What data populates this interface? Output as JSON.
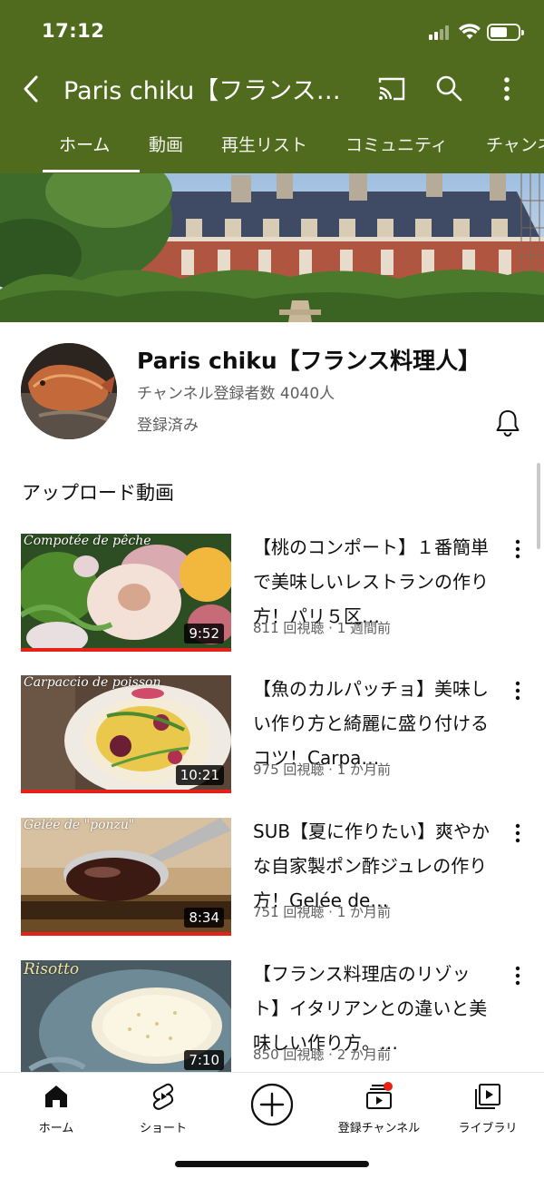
{
  "status_bar": {
    "time": "17:12"
  },
  "header": {
    "channel_title": "Paris chiku【フランス料理人】",
    "icons": [
      "back-icon",
      "cast-icon",
      "search-icon",
      "more-vert-icon"
    ],
    "tabs": [
      {
        "label": "ホーム",
        "active": true
      },
      {
        "label": "動画",
        "active": false
      },
      {
        "label": "再生リスト",
        "active": false
      },
      {
        "label": "コミュニティ",
        "active": false
      },
      {
        "label": "チャンネル",
        "active": false
      }
    ]
  },
  "channel": {
    "name": "Paris chiku【フランス料理人】",
    "subscribers": "チャンネル登録者数 4040人",
    "subscribed_label": "登録済み"
  },
  "section": {
    "title": "アップロード動画"
  },
  "videos": [
    {
      "thumb_text": "Compotée de pêche",
      "duration": "9:52",
      "title": "【桃のコンポート】１番簡単で美味しいレストランの作り方！パリ５区…",
      "meta": "811 回視聴 · 1 週間前"
    },
    {
      "thumb_text": "Carpaccio de poisson",
      "duration": "10:21",
      "title": "【魚のカルパッチョ】美味しい作り方と綺麗に盛り付けるコツ！Carpa…",
      "meta": "975 回視聴 · 1 か月前"
    },
    {
      "thumb_text": "Gelée de \"ponzu\"",
      "duration": "8:34",
      "title": "SUB【夏に作りたい】爽やかな自家製ポン酢ジュレの作り方！Gelée de…",
      "meta": "751 回視聴 · 1 か月前"
    },
    {
      "thumb_text": "Risotto",
      "duration": "7:10",
      "title": "【フランス料理店のリゾット】イタリアンとの違いと美味しい作り方。…",
      "meta": "850 回視聴 · 2 か月前"
    }
  ],
  "bottom_nav": [
    {
      "label": "ホーム",
      "icon": "home-icon"
    },
    {
      "label": "ショート",
      "icon": "shorts-icon"
    },
    {
      "label": "",
      "icon": "create-icon"
    },
    {
      "label": "登録チャンネル",
      "icon": "subscriptions-icon"
    },
    {
      "label": "ライブラリ",
      "icon": "library-icon"
    }
  ],
  "colors": {
    "header_bg": "#506b1e",
    "progress": "#e62117",
    "badge": "#e62117"
  }
}
